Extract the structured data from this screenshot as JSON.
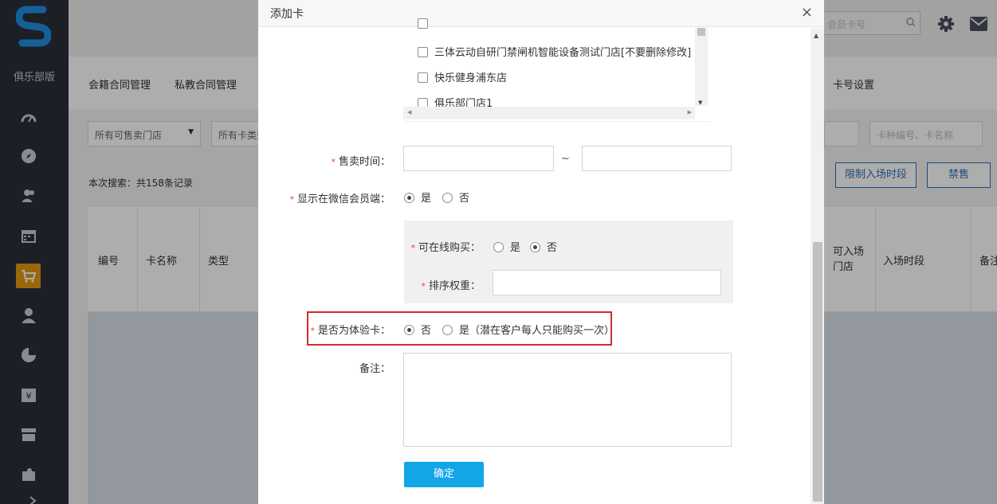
{
  "app": {
    "sidebar_title": "俱乐部版",
    "search_placeholder": "会员卡号",
    "tabs": [
      "会籍合同管理",
      "私教合同管理",
      "卡号设置"
    ],
    "filters": {
      "store_select": "所有可售卖门店",
      "type_select": "所有卡类型",
      "keyword_placeholder": "卡种编号、卡名称"
    },
    "record_count": "本次搜索：共158条记录",
    "buttons": {
      "limit_time": "限制入场时段",
      "ban_sale": "禁售"
    },
    "table_headers": [
      "编号",
      "卡名称",
      "类型",
      "可入场门店",
      "入场时段",
      "备注"
    ],
    "colors": {
      "sidebar": "#2b2f3a",
      "accent_active": "#e39a12",
      "primary_blue": "#2d6db5"
    }
  },
  "modal": {
    "title": "添加卡",
    "close_icon": "×",
    "stores": [
      "三体云动自研门禁闸机智能设备测试门店[不要删除修改]",
      "快乐健身浦东店",
      "俱乐部门店1"
    ],
    "sale_time": {
      "label": "售卖时间：",
      "separator": "~"
    },
    "show_wechat": {
      "label": "显示在微信会员端：",
      "yes": "是",
      "no": "否",
      "selected": "yes"
    },
    "online_buy": {
      "label": "可在线购买：",
      "yes": "是",
      "no": "否",
      "selected": "no"
    },
    "sort_weight": {
      "label": "排序权重："
    },
    "trial_card": {
      "label": "是否为体验卡：",
      "no": "否",
      "yes": "是（潜在客户每人只能购买一次）",
      "selected": "no"
    },
    "remark": {
      "label": "备注："
    },
    "confirm_button": "确定",
    "colors": {
      "confirm": "#12a5e8",
      "highlight_border": "#d12b2b",
      "required": "#e64b3b"
    }
  }
}
